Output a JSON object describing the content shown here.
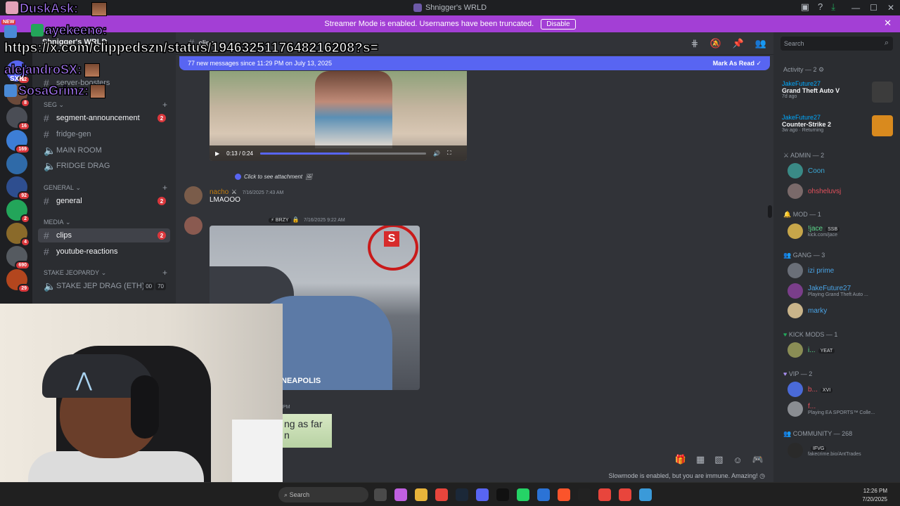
{
  "window": {
    "title": "Shnigger's WRLD"
  },
  "banner": {
    "text": "Streamer Mode is enabled. Usernames have been truncated.",
    "disable_label": "Disable"
  },
  "server": {
    "name": "Shnigger's WRLD"
  },
  "guilds": [
    {
      "badge": "32",
      "color": "#5865f2"
    },
    {
      "badge": "8",
      "color": "#6b4a3a"
    },
    {
      "badge": "16",
      "color": "#4a4d55"
    },
    {
      "badge": "169",
      "color": "#3d7ed6"
    },
    {
      "badge": "",
      "color": "#2f6aa8"
    },
    {
      "badge": "92",
      "color": "#2e4e8f"
    },
    {
      "badge": "2",
      "color": "#23a55a"
    },
    {
      "badge": "4",
      "color": "#8a6a2a"
    },
    {
      "badge": "690",
      "color": "#555a60"
    },
    {
      "badge": "29",
      "color": "#b3461e"
    }
  ],
  "channels": {
    "top_items": [
      {
        "label": "server-boosters"
      }
    ],
    "categories": [
      {
        "label": "SEG",
        "collapsed": true
      },
      {
        "label": "General",
        "collapsed": true
      },
      {
        "label": "MEDIA",
        "collapsed": true
      },
      {
        "label": "STAKE JEOPARDY",
        "collapsed": true
      }
    ],
    "items": [
      {
        "label": "segment-announcement",
        "type": "text",
        "badge": "2"
      },
      {
        "label": "fridge-gen",
        "type": "text",
        "badge": ""
      },
      {
        "label": "MAIN ROOM",
        "type": "voice",
        "badge": ""
      },
      {
        "label": "FRIDGE DRAG",
        "type": "voice",
        "badge": ""
      },
      {
        "label": "general",
        "type": "text",
        "badge": "2"
      },
      {
        "label": "clips",
        "type": "text",
        "badge": "2"
      },
      {
        "label": "youtube-reactions",
        "type": "text",
        "badge": ""
      },
      {
        "label": "STAKE JEP DRAG (ETH)",
        "type": "voice",
        "badge": "",
        "users": "00",
        "limit": "70"
      }
    ]
  },
  "main": {
    "channel_name": "clips",
    "new_messages": "77 new messages since 11:29 PM on July 13, 2025",
    "mark_read": "Mark As Read",
    "video": {
      "time": "0:13 / 0:24",
      "progress": 0.54
    },
    "reply_preview": "Click to see attachment",
    "message1": {
      "author": "nacho",
      "time": "7/16/2025 7:43 AM",
      "text": "LMAOOO"
    },
    "message2": {
      "tag": "BRZY",
      "time": "7/16/2025 9:22 AM",
      "photo_sign": "S",
      "patch_text": "NEAPOLIS"
    },
    "message3": {
      "time_fragment": "PM",
      "snippet_text": "ng as far n"
    },
    "slowmode": "Slowmode is enabled, but you are immune. Amazing!",
    "search_placeholder": "Search"
  },
  "members": {
    "activity_header": "Activity — 2",
    "activities": [
      {
        "who": "JakeFuture27",
        "game": "Grand Theft Auto V",
        "meta": "7d ago",
        "icon_color": "#3c3c3c"
      },
      {
        "who": "JakeFuture27",
        "game": "Counter-Strike 2",
        "meta": "3w ago  ·  Returning",
        "icon_color": "#d98a1e"
      }
    ],
    "sections": [
      {
        "label": "ADMIN — 2"
      },
      {
        "label": "MOD — 1"
      },
      {
        "label": "GANG — 3"
      },
      {
        "label": "KICK MODS — 1"
      },
      {
        "label": "VIP — 2"
      },
      {
        "label": "COMMUNITY — 268"
      }
    ],
    "list": [
      {
        "name": "Coon",
        "status": "",
        "tag": "",
        "color": "#3ba9d6",
        "avatar": "#3a8a86"
      },
      {
        "name": "ohsheluvsj",
        "status": "",
        "tag": "",
        "color": "#e2505b",
        "avatar": "#7a6a6a"
      },
      {
        "name": "!jace",
        "status": "kick.com/jace",
        "tag": "SSB",
        "color": "#5bd68a",
        "avatar": "#c7a64a"
      },
      {
        "name": "izi prime",
        "status": "",
        "tag": "",
        "color": "#4aa4e6",
        "avatar": "#6a6f78"
      },
      {
        "name": "JakeFuture27",
        "status": "Playing Grand Theft Auto ...",
        "tag": "",
        "color": "#4aa4e6",
        "avatar": "#7a3e8a"
      },
      {
        "name": "marky",
        "status": "",
        "tag": "",
        "color": "#4aa4e6",
        "avatar": "#c9b48a"
      },
      {
        "name": "i...",
        "status": "",
        "tag": "YEAT",
        "color": "#5bd68a",
        "avatar": "#8a8d55"
      },
      {
        "name": "b...",
        "status": "",
        "tag": "XVI",
        "color": "#e2505b",
        "avatar": "#4a6ad8"
      },
      {
        "name": "f...",
        "status": "Playing EA SPORTS™ Colle...",
        "tag": "",
        "color": "#e2505b",
        "avatar": "#8a8d92"
      },
      {
        "name": "",
        "status": "fakecrime.bio/AntTrades",
        "tag": "IFVG",
        "color": "#dbdee1",
        "avatar": "#2a2a2a"
      }
    ],
    "search_placeholder": "Search"
  },
  "overlay": {
    "chat": [
      {
        "name": "DuskAsk:"
      },
      {
        "name": "ayekeeno:"
      },
      {
        "name": "alejandroSX:"
      },
      {
        "name": "SosaGrimz:"
      }
    ],
    "url": "https://x.com/clippedszn/status/1946325117648216208?s=",
    "tag_new": "NEW",
    "tag_sxk": "SXK"
  },
  "taskbar": {
    "search_label": "Search",
    "time": "12:26 PM",
    "date": "7/20/2025"
  }
}
